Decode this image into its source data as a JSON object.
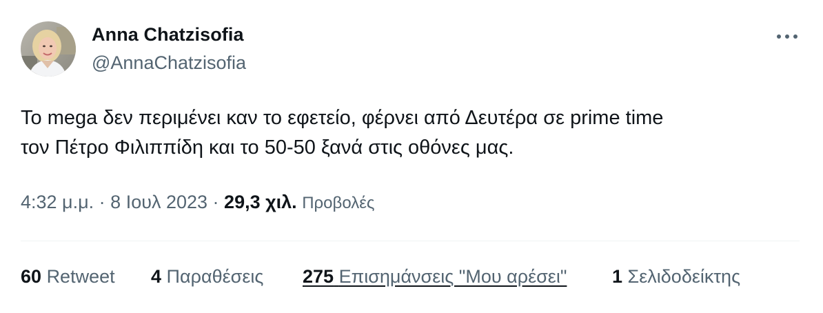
{
  "author": {
    "name": "Anna Chatzisofia",
    "handle": "@AnnaChatzisofia",
    "avatar_icon": "profile-photo-icon"
  },
  "menu": {
    "icon": "more-horizontal-icon"
  },
  "tweet": {
    "lines": [
      "Το mega δεν περιμένει καν το εφετείο, φέρνει από Δευτέρα σε prime time",
      "τον Πέτρο Φιλιππίδη και το 50-50 ξανά στις οθόνες μας."
    ]
  },
  "meta": {
    "time": "4:32 μ.μ.",
    "separator": " · ",
    "date": "8 Ιουλ 2023",
    "views_count": "29,3 χιλ.",
    "views_label": "Προβολές"
  },
  "stats": [
    {
      "count": "60",
      "label": "Retweet"
    },
    {
      "count": "4",
      "label": "Παραθέσεις"
    },
    {
      "count": "275",
      "label": "Επισημάνσεις \"Μου αρέσει\""
    },
    {
      "count": "1",
      "label": "Σελιδοδείκτης"
    }
  ],
  "colors": {
    "text_primary": "#0f1419",
    "text_secondary": "#536471",
    "divider": "#eff3f4",
    "background": "#ffffff"
  }
}
